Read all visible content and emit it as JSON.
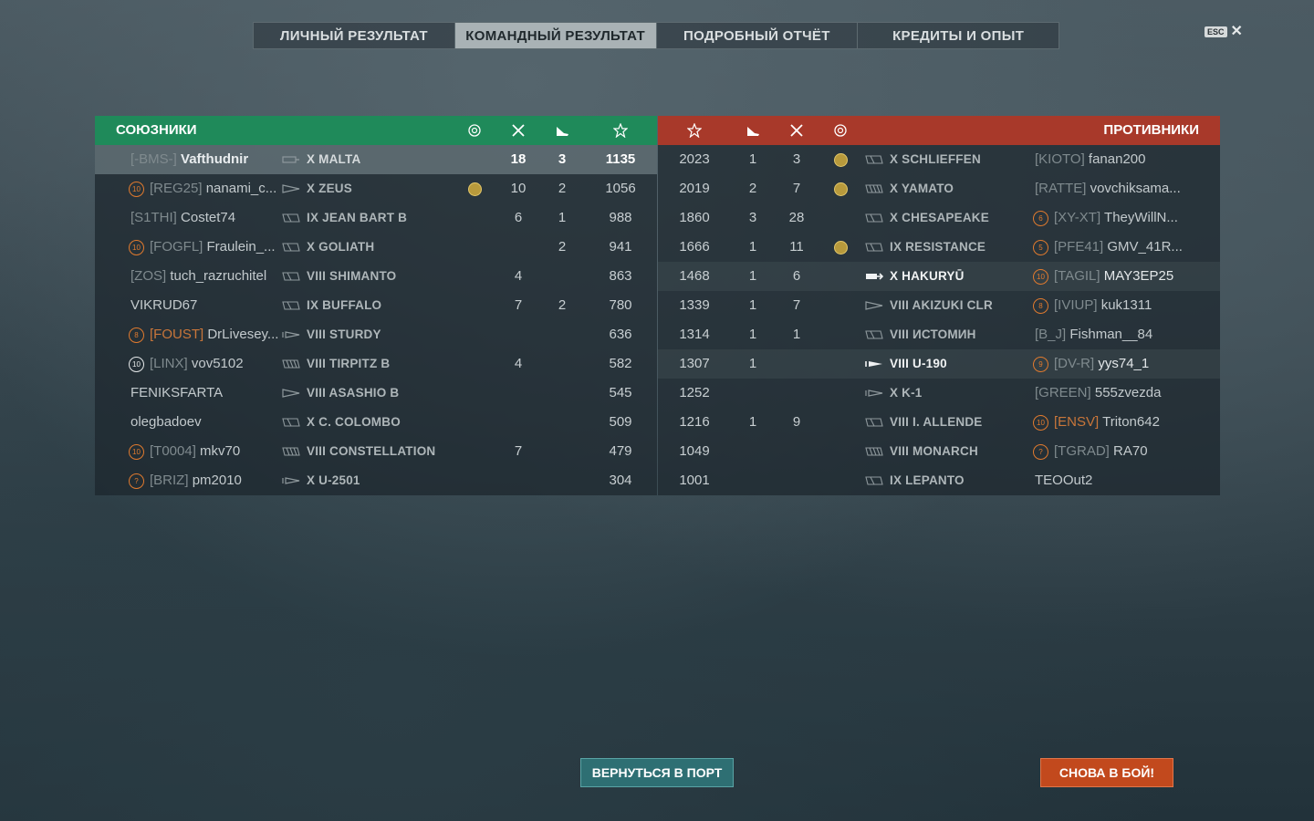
{
  "tabs": [
    {
      "label": "ЛИЧНЫЙ РЕЗУЛЬТАТ",
      "active": false
    },
    {
      "label": "КОМАНДНЫЙ РЕЗУЛЬТАТ",
      "active": true
    },
    {
      "label": "ПОДРОБНЫЙ ОТЧЁТ",
      "active": false
    },
    {
      "label": "КРЕДИТЫ И ОПЫТ",
      "active": false
    }
  ],
  "close": {
    "key_label": "ESC",
    "icon": "close-icon"
  },
  "allies": {
    "title": "СОЮЗНИКИ",
    "column_icons": [
      "medal-icon",
      "kills-icon",
      "planes-icon",
      "star-icon"
    ],
    "rows": [
      {
        "rank": "",
        "clan": "[-BMS-]",
        "name": "Vafthudnir",
        "ship_icon": "carrier-icon",
        "ship": "X MALTA",
        "medal": false,
        "kills": "18",
        "planes": "3",
        "exp": "1135",
        "selected": true
      },
      {
        "rank": "10",
        "clan": "[REG25]",
        "name": "nanami_c...",
        "ship_icon": "destroyer-icon",
        "ship": "X ZEUS",
        "medal": true,
        "kills": "10",
        "planes": "2",
        "exp": "1056"
      },
      {
        "rank": "",
        "clan": "[S1THI]",
        "name": "Costet74",
        "ship_icon": "cruiser-icon",
        "ship": "IX JEAN BART B",
        "medal": false,
        "kills": "6",
        "planes": "1",
        "exp": "988"
      },
      {
        "rank": "10",
        "clan": "[FOGFL]",
        "name": "Fraulein_...",
        "ship_icon": "cruiser-icon",
        "ship": "X GOLIATH",
        "medal": false,
        "kills": "",
        "planes": "2",
        "exp": "941"
      },
      {
        "rank": "",
        "clan": "[ZOS]",
        "name": "tuch_razruchitel",
        "ship_icon": "cruiser-icon",
        "ship": "VIII SHIMANTO",
        "medal": false,
        "kills": "4",
        "planes": "",
        "exp": "863"
      },
      {
        "rank": "",
        "clan": "",
        "name": "VIKRUD67",
        "ship_icon": "cruiser-icon",
        "ship": "IX BUFFALO",
        "medal": false,
        "kills": "7",
        "planes": "2",
        "exp": "780"
      },
      {
        "rank": "8",
        "clan": "[FOUST]",
        "name": "DrLivesey...",
        "ship_icon": "submarine-icon",
        "ship": "VIII STURDY",
        "medal": false,
        "kills": "",
        "planes": "",
        "exp": "636",
        "clan_orange": true
      },
      {
        "rank": "10",
        "clan": "[LINX]",
        "name": "vov5102",
        "ship_icon": "battleship-icon",
        "ship": "VIII TIRPITZ B",
        "medal": false,
        "kills": "4",
        "planes": "",
        "exp": "582",
        "rank_white": true
      },
      {
        "rank": "",
        "clan": "",
        "name": "FENIKSFARTA",
        "ship_icon": "destroyer-icon",
        "ship": "VIII ASASHIO B",
        "medal": false,
        "kills": "",
        "planes": "",
        "exp": "545"
      },
      {
        "rank": "",
        "clan": "",
        "name": "olegbadoev",
        "ship_icon": "cruiser-icon",
        "ship": "X C. COLOMBO",
        "medal": false,
        "kills": "",
        "planes": "",
        "exp": "509"
      },
      {
        "rank": "10",
        "clan": "[T0004]",
        "name": "mkv70",
        "ship_icon": "battleship-icon",
        "ship": "VIII CONSTELLATION",
        "medal": false,
        "kills": "7",
        "planes": "",
        "exp": "479"
      },
      {
        "rank": "?",
        "clan": "[BRIZ]",
        "name": "pm2010",
        "ship_icon": "submarine-icon",
        "ship": "X U-2501",
        "medal": false,
        "kills": "",
        "planes": "",
        "exp": "304"
      }
    ]
  },
  "enemies": {
    "title": "ПРОТИВНИКИ",
    "column_icons": [
      "star-icon",
      "planes-icon",
      "kills-icon",
      "medal-icon"
    ],
    "rows": [
      {
        "exp": "2023",
        "planes": "1",
        "kills": "3",
        "medal": true,
        "ship_icon": "cruiser-icon",
        "ship": "X SCHLIEFFEN",
        "rank": "",
        "clan": "[KIOTO]",
        "name": "fanan200"
      },
      {
        "exp": "2019",
        "planes": "2",
        "kills": "7",
        "medal": true,
        "ship_icon": "battleship-icon",
        "ship": "X YAMATO",
        "rank": "",
        "clan": "[RATTE]",
        "name": "vovchiksama..."
      },
      {
        "exp": "1860",
        "planes": "3",
        "kills": "28",
        "medal": false,
        "ship_icon": "cruiser-icon",
        "ship": "X CHESAPEAKE",
        "rank": "6",
        "clan": "[XY-XT]",
        "name": "TheyWillN..."
      },
      {
        "exp": "1666",
        "planes": "1",
        "kills": "11",
        "medal": true,
        "ship_icon": "cruiser-icon",
        "ship": "IX RESISTANCE",
        "rank": "5",
        "clan": "[PFE41]",
        "name": "GMV_41R..."
      },
      {
        "exp": "1468",
        "planes": "1",
        "kills": "6",
        "medal": false,
        "ship_icon": "carrier-white-icon",
        "ship": "X HAKURYŪ",
        "rank": "10",
        "clan": "[TAGIL]",
        "name": "MAY3EP25",
        "highlight": true
      },
      {
        "exp": "1339",
        "planes": "1",
        "kills": "7",
        "medal": false,
        "ship_icon": "destroyer-icon",
        "ship": "VIII AKIZUKI CLR",
        "rank": "8",
        "clan": "[IVIUP]",
        "name": "kuk1311"
      },
      {
        "exp": "1314",
        "planes": "1",
        "kills": "1",
        "medal": false,
        "ship_icon": "cruiser-icon",
        "ship": "VIII ИСТОМИН",
        "rank": "",
        "clan": "[B_J]",
        "name": "Fishman__84"
      },
      {
        "exp": "1307",
        "planes": "1",
        "kills": "",
        "medal": false,
        "ship_icon": "submarine-white-icon",
        "ship": "VIII U-190",
        "rank": "9",
        "clan": "[DV-R]",
        "name": "yys74_1",
        "highlight": true
      },
      {
        "exp": "1252",
        "planes": "",
        "kills": "",
        "medal": false,
        "ship_icon": "submarine-icon",
        "ship": "X K-1",
        "rank": "",
        "clan": "[GREEN]",
        "name": "555zvezda"
      },
      {
        "exp": "1216",
        "planes": "1",
        "kills": "9",
        "medal": false,
        "ship_icon": "cruiser-icon",
        "ship": "VIII I. ALLENDE",
        "rank": "10",
        "clan": "[ENSV]",
        "name": "Triton642",
        "clan_orange": true
      },
      {
        "exp": "1049",
        "planes": "",
        "kills": "",
        "medal": false,
        "ship_icon": "battleship-icon",
        "ship": "VIII MONARCH",
        "rank": "?",
        "clan": "[TGRAD]",
        "name": "RA70"
      },
      {
        "exp": "1001",
        "planes": "",
        "kills": "",
        "medal": false,
        "ship_icon": "cruiser-icon",
        "ship": "IX LEPANTO",
        "rank": "",
        "clan": "",
        "name": "TEOOut2"
      }
    ]
  },
  "buttons": {
    "port": "ВЕРНУТЬСЯ В ПОРТ",
    "battle": "СНОВА В БОЙ!"
  },
  "colors": {
    "allies": "#1f8a5a",
    "enemies": "#a8392a",
    "battle_button": "#c2491d",
    "port_button": "#2e6f73",
    "rank_orange": "#e07a2e"
  }
}
